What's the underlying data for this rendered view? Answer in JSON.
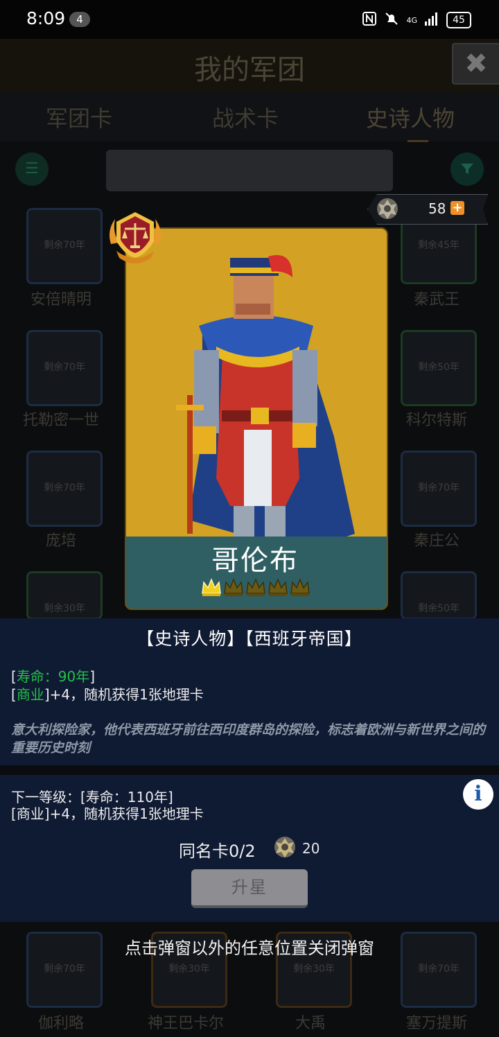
{
  "status": {
    "time": "8:09",
    "badge": "4",
    "network": "4G",
    "battery": "45"
  },
  "header": {
    "title": "我的军团"
  },
  "tabs": [
    {
      "label": "军团卡"
    },
    {
      "label": "战术卡"
    },
    {
      "label": "史诗人物"
    }
  ],
  "currency": {
    "amount": "58",
    "plus": "+"
  },
  "background_cards": {
    "row1": [
      {
        "left": "剩余70年",
        "name": "安倍晴明"
      },
      {
        "left": "剩余45年",
        "name": "秦武王"
      }
    ],
    "row2": [
      {
        "left": "剩余70年",
        "name": "托勒密一世"
      },
      {
        "left": "剩余50年",
        "name": "科尔特斯"
      }
    ],
    "row3": [
      {
        "left": "剩余70年",
        "name": "庞培"
      },
      {
        "left": "剩余70年",
        "name": "秦庄公"
      }
    ],
    "row4": [
      {
        "left": "剩余30年"
      },
      {
        "left": "剩余50年"
      }
    ],
    "row7": [
      {
        "left": "剩余70年",
        "name": "伽利略"
      },
      {
        "left": "剩余30年",
        "name": "神王巴卡尔"
      },
      {
        "left": "剩余30年",
        "name": "大禹"
      },
      {
        "left": "剩余70年",
        "name": "塞万提斯"
      }
    ]
  },
  "card": {
    "name": "哥伦布",
    "crowns_total": 5,
    "crowns_filled": 1
  },
  "popup": {
    "tags": "【史诗人物】【西班牙帝国】",
    "lifespan_open": "[",
    "lifespan": "寿命：90年",
    "lifespan_close": "]",
    "skill_tag": "商业",
    "skill_text": "+4，随机获得1张地理卡",
    "description": "意大利探险家，他代表西班牙前往西印度群岛的探险，标志着欧洲与新世界之间的重要历史时刻",
    "next_level_line1": "下一等级：[寿命：110年]",
    "next_level_line2": "[商业]+4，随机获得1张地理卡",
    "info": "i",
    "same_card_label": "同名卡0/2",
    "same_card_cost": "20",
    "upgrade_label": "升星",
    "close_hint": "点击弹窗以外的任意位置关闭弹窗"
  },
  "colors": {
    "accent_green": "#27c04a",
    "panel": "#0f1a33",
    "card_bg": "#d3a224",
    "plus": "#f09028"
  }
}
